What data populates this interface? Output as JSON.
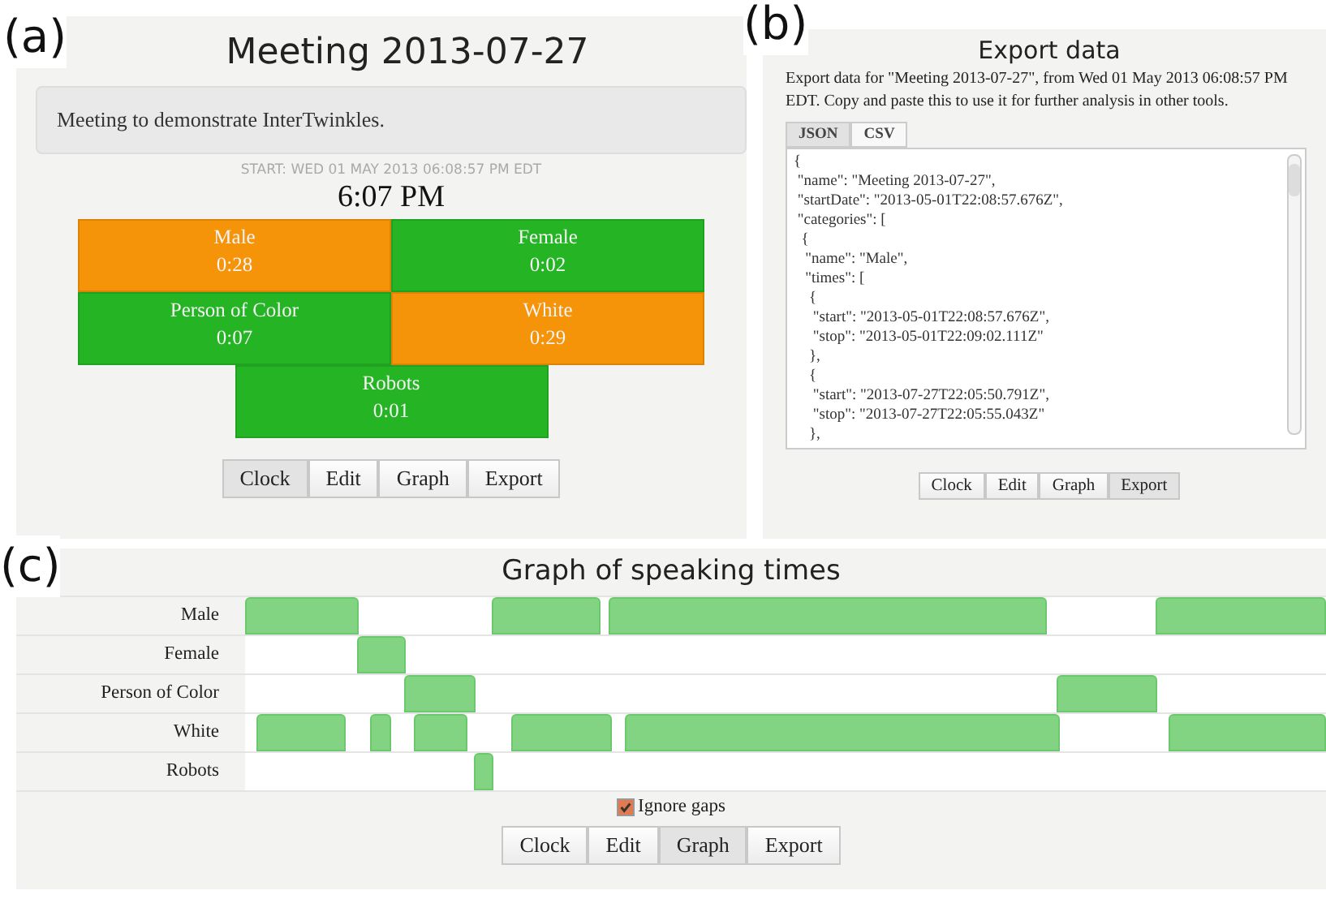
{
  "panel_a": {
    "label": "(a)",
    "title": "Meeting 2013-07-27",
    "description": "Meeting to demonstrate InterTwinkles.",
    "start": "START: WED 01 MAY 2013 06:08:57 PM EDT",
    "clock": "6:07 PM",
    "categories": [
      {
        "name": "Male",
        "time": "0:28",
        "color": "#f59309"
      },
      {
        "name": "Female",
        "time": "0:02",
        "color": "#24b424"
      },
      {
        "name": "Person of Color",
        "time": "0:07",
        "color": "#24b424"
      },
      {
        "name": "White",
        "time": "0:29",
        "color": "#f59309"
      },
      {
        "name": "Robots",
        "time": "0:01",
        "color": "#24b424"
      }
    ],
    "nav": [
      {
        "label": "Clock",
        "selected": true
      },
      {
        "label": "Edit",
        "selected": false
      },
      {
        "label": "Graph",
        "selected": false
      },
      {
        "label": "Export",
        "selected": false
      }
    ]
  },
  "panel_b": {
    "label": "(b)",
    "title": "Export data",
    "description": "Export data for \"Meeting 2013-07-27\", from Wed 01 May 2013 06:08:57 PM EDT. Copy and paste this to use it for further analysis in other tools.",
    "tabs": [
      {
        "label": "JSON",
        "selected": true
      },
      {
        "label": "CSV",
        "selected": false
      }
    ],
    "export_text": "{\n \"name\": \"Meeting 2013-07-27\",\n \"startDate\": \"2013-05-01T22:08:57.676Z\",\n \"categories\": [\n  {\n   \"name\": \"Male\",\n   \"times\": [\n    {\n     \"start\": \"2013-05-01T22:08:57.676Z\",\n     \"stop\": \"2013-05-01T22:09:02.111Z\"\n    },\n    {\n     \"start\": \"2013-07-27T22:05:50.791Z\",\n     \"stop\": \"2013-07-27T22:05:55.043Z\"\n    },",
    "nav": [
      {
        "label": "Clock",
        "selected": false
      },
      {
        "label": "Edit",
        "selected": false
      },
      {
        "label": "Graph",
        "selected": false
      },
      {
        "label": "Export",
        "selected": true
      }
    ]
  },
  "panel_c": {
    "label": "(c)",
    "title": "Graph of speaking times",
    "rows": [
      "Male",
      "Female",
      "Person of Color",
      "White",
      "Robots"
    ],
    "ignore_gaps": {
      "label": "Ignore gaps",
      "checked": true
    },
    "nav": [
      {
        "label": "Clock",
        "selected": false
      },
      {
        "label": "Edit",
        "selected": false
      },
      {
        "label": "Graph",
        "selected": true
      },
      {
        "label": "Export",
        "selected": false
      }
    ]
  }
}
